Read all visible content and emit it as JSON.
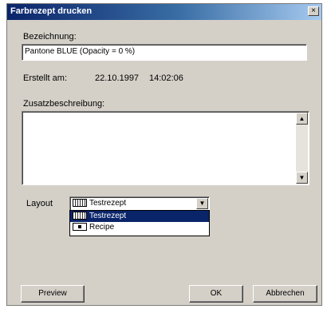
{
  "window": {
    "title": "Farbrezept drucken",
    "close_glyph": "×"
  },
  "bezeichnung": {
    "label": "Bezeichnung:",
    "value": "Pantone BLUE (Opacity = 0 %)"
  },
  "erstellt": {
    "label": "Erstellt am:",
    "date": "22.10.1997",
    "time": "14:02:06"
  },
  "zusatz": {
    "label": "Zusatzbeschreibung:",
    "value": ""
  },
  "layout": {
    "label": "Layout",
    "selected": "Testrezept",
    "options": [
      {
        "label": "Testrezept",
        "icon": "layout-icon",
        "selected": true
      },
      {
        "label": "Recipe",
        "icon": "recipe-icon",
        "selected": false
      }
    ]
  },
  "buttons": {
    "preview": "Preview",
    "ok": "OK",
    "cancel": "Abbrechen"
  },
  "colors": {
    "title_start": "#0a246a",
    "title_end": "#a6caf0",
    "face": "#d4d0c8",
    "selection": "#0a246a"
  }
}
